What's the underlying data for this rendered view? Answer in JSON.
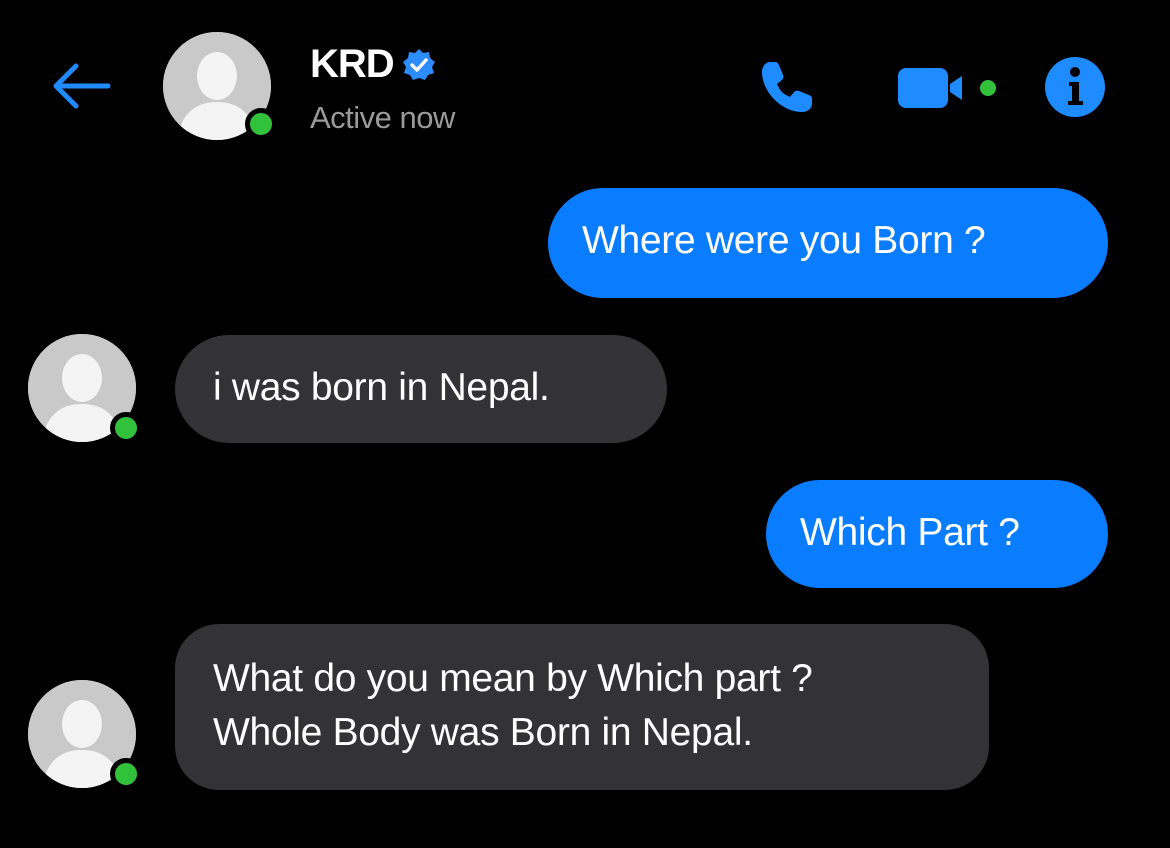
{
  "header": {
    "contact_name": "KRD",
    "status": "Active now",
    "icons": {
      "back": "back-arrow-icon",
      "verified": "verified-badge-icon",
      "call": "phone-call-icon",
      "video": "video-call-icon",
      "info": "info-icon"
    }
  },
  "colors": {
    "accent": "#0a7cff",
    "incoming_bubble": "#333335",
    "online": "#31c13a",
    "background": "#000000",
    "status_text": "#9a9a9a"
  },
  "messages": [
    {
      "direction": "outgoing",
      "text": "Where were you Born ?"
    },
    {
      "direction": "incoming",
      "text": "i was born in Nepal."
    },
    {
      "direction": "outgoing",
      "text": "Which Part ?"
    },
    {
      "direction": "incoming",
      "lines": [
        "What do you mean by Which part ?",
        "Whole Body was Born in Nepal."
      ]
    }
  ]
}
